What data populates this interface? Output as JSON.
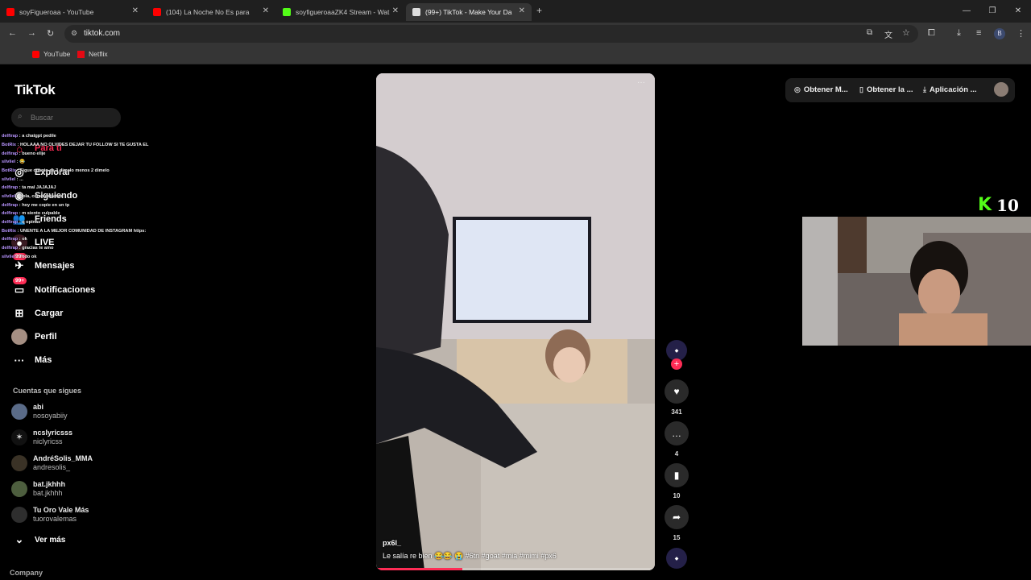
{
  "browser": {
    "tabs": [
      {
        "title": "soyFigueroaa - YouTube",
        "fav_color": "#ff0000"
      },
      {
        "title": "(104) La Noche No Es para",
        "fav_color": "#ff0000"
      },
      {
        "title": "soyfigueroaaZK4 Stream - Wat",
        "fav_color": "#53fc18"
      },
      {
        "title": "(99+) TikTok - Make Your Da",
        "fav_color": "#ffffff"
      }
    ],
    "url": "tiktok.com",
    "bookmarks": [
      {
        "label": "YouTube",
        "color": "#ff0000"
      },
      {
        "label": "Netflix",
        "color": "#e50914"
      }
    ],
    "profile_initial": "B"
  },
  "tiktok": {
    "logo": "TikTok",
    "search_placeholder": "Buscar",
    "nav": [
      {
        "label": "Para ti",
        "icon": "home-icon"
      },
      {
        "label": "Explorar",
        "icon": "compass-icon"
      },
      {
        "label": "Siguiendo",
        "icon": "following-icon"
      },
      {
        "label": "Friends",
        "icon": "friends-icon"
      },
      {
        "label": "LIVE",
        "icon": "live-icon"
      },
      {
        "label": "Mensajes",
        "icon": "message-icon",
        "badge": "99+"
      },
      {
        "label": "Notificaciones",
        "icon": "bell-icon",
        "badge": "99+"
      },
      {
        "label": "Cargar",
        "icon": "upload-icon"
      },
      {
        "label": "Perfil",
        "icon": "profile-icon"
      },
      {
        "label": "Más",
        "icon": "more-icon"
      }
    ],
    "following_title": "Cuentas que sigues",
    "following": [
      {
        "name": "abi",
        "username": "nosoyabiiy"
      },
      {
        "name": "ncslyricsss",
        "username": "niclyricss"
      },
      {
        "name": "AndréSolis_MMA",
        "username": "andresolis_"
      },
      {
        "name": "bat.jkhhh",
        "username": "bat.jkhhh"
      },
      {
        "name": "Tu Oro Vale Más",
        "username": "tuorovalemas"
      }
    ],
    "see_more": "Ver más",
    "company": "Company",
    "video": {
      "author": "px6l_",
      "caption": "Le salía re bien 😂😂 😭 #6tn #goat #mia #mimi #px6",
      "progress": 0.31,
      "likes": "341",
      "comments": "4",
      "saves": "10",
      "shares": "15"
    },
    "top_right": {
      "item1": "Obtener M...",
      "item2": "Obtener la ...",
      "item3": "Aplicación ..."
    }
  },
  "chat": [
    {
      "user": "delfirap",
      "msg": "a chatgpt pedile"
    },
    {
      "user": "BotRix",
      "msg": "HOLAAA NO OLVIDES DEJAR TU FOLLOW SI TE GUSTA EL"
    },
    {
      "user": "delfirap",
      "msg": "bueno elije"
    },
    {
      "user": "silvliel",
      "msg": "😂"
    },
    {
      "user": "BotRix",
      "msg": "Figue cuanto es 3 dimelo menos 2 dimelo"
    },
    {
      "user": "silvliel",
      "msg": "..."
    },
    {
      "user": "delfirap",
      "msg": "ta mal JAJAJAJ"
    },
    {
      "user": "silvliel",
      "msg": "Hola, como estamos"
    },
    {
      "user": "delfirap",
      "msg": "hoy me copie en un tp"
    },
    {
      "user": "delfirap",
      "msg": "m siento culpable"
    },
    {
      "user": "delfirap",
      "msg": "q opinas"
    },
    {
      "user": "BotRix",
      "msg": "UNENTE A LA MEJOR COMUNIDAD DE INSTAGRAM https:"
    },
    {
      "user": "delfirap",
      "msg": "ok"
    },
    {
      "user": "delfirap",
      "msg": "gracias te amo"
    },
    {
      "user": "silvliel",
      "msg": "Todo ok"
    }
  ],
  "kick": {
    "logo": "K",
    "viewers": "10"
  }
}
